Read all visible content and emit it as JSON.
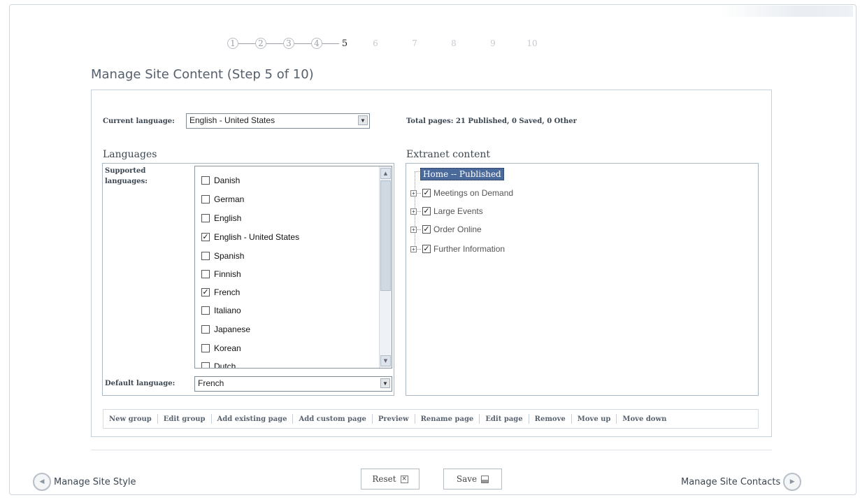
{
  "steps": [
    "1",
    "2",
    "3",
    "4",
    "5",
    "6",
    "7",
    "8",
    "9",
    "10"
  ],
  "current_step": 5,
  "page_title": "Manage Site Content (Step 5 of 10)",
  "current_language": {
    "label": "Current language:",
    "value": "English - United States"
  },
  "total_pages": "Total pages: 21 Published, 0 Saved, 0 Other",
  "languages": {
    "title": "Languages",
    "supported_label_line1": "Supported",
    "supported_label_line2": "languages:",
    "items": [
      {
        "label": "Danish",
        "checked": false
      },
      {
        "label": "German",
        "checked": false
      },
      {
        "label": "English",
        "checked": false
      },
      {
        "label": "English - United States",
        "checked": true
      },
      {
        "label": "Spanish",
        "checked": false
      },
      {
        "label": "Finnish",
        "checked": false
      },
      {
        "label": "French",
        "checked": true
      },
      {
        "label": "Italiano",
        "checked": false
      },
      {
        "label": "Japanese",
        "checked": false
      },
      {
        "label": "Korean",
        "checked": false
      },
      {
        "label": "Dutch",
        "checked": false
      }
    ],
    "default_label": "Default language:",
    "default_value": "French"
  },
  "extranet": {
    "title": "Extranet content",
    "root": "Home -- Published",
    "nodes": [
      {
        "label": "Meetings on Demand",
        "checked": true
      },
      {
        "label": "Large Events",
        "checked": true
      },
      {
        "label": "Order Online",
        "checked": true
      },
      {
        "label": "Further Information",
        "checked": true
      }
    ]
  },
  "toolbar": [
    "New group",
    "Edit group",
    "Add existing page",
    "Add custom page",
    "Preview",
    "Rename page",
    "Edit page",
    "Remove",
    "Move up",
    "Move down"
  ],
  "nav": {
    "prev": "Manage Site Style",
    "next": "Manage Site Contacts"
  },
  "actions": {
    "reset": "Reset",
    "save": "Save"
  }
}
